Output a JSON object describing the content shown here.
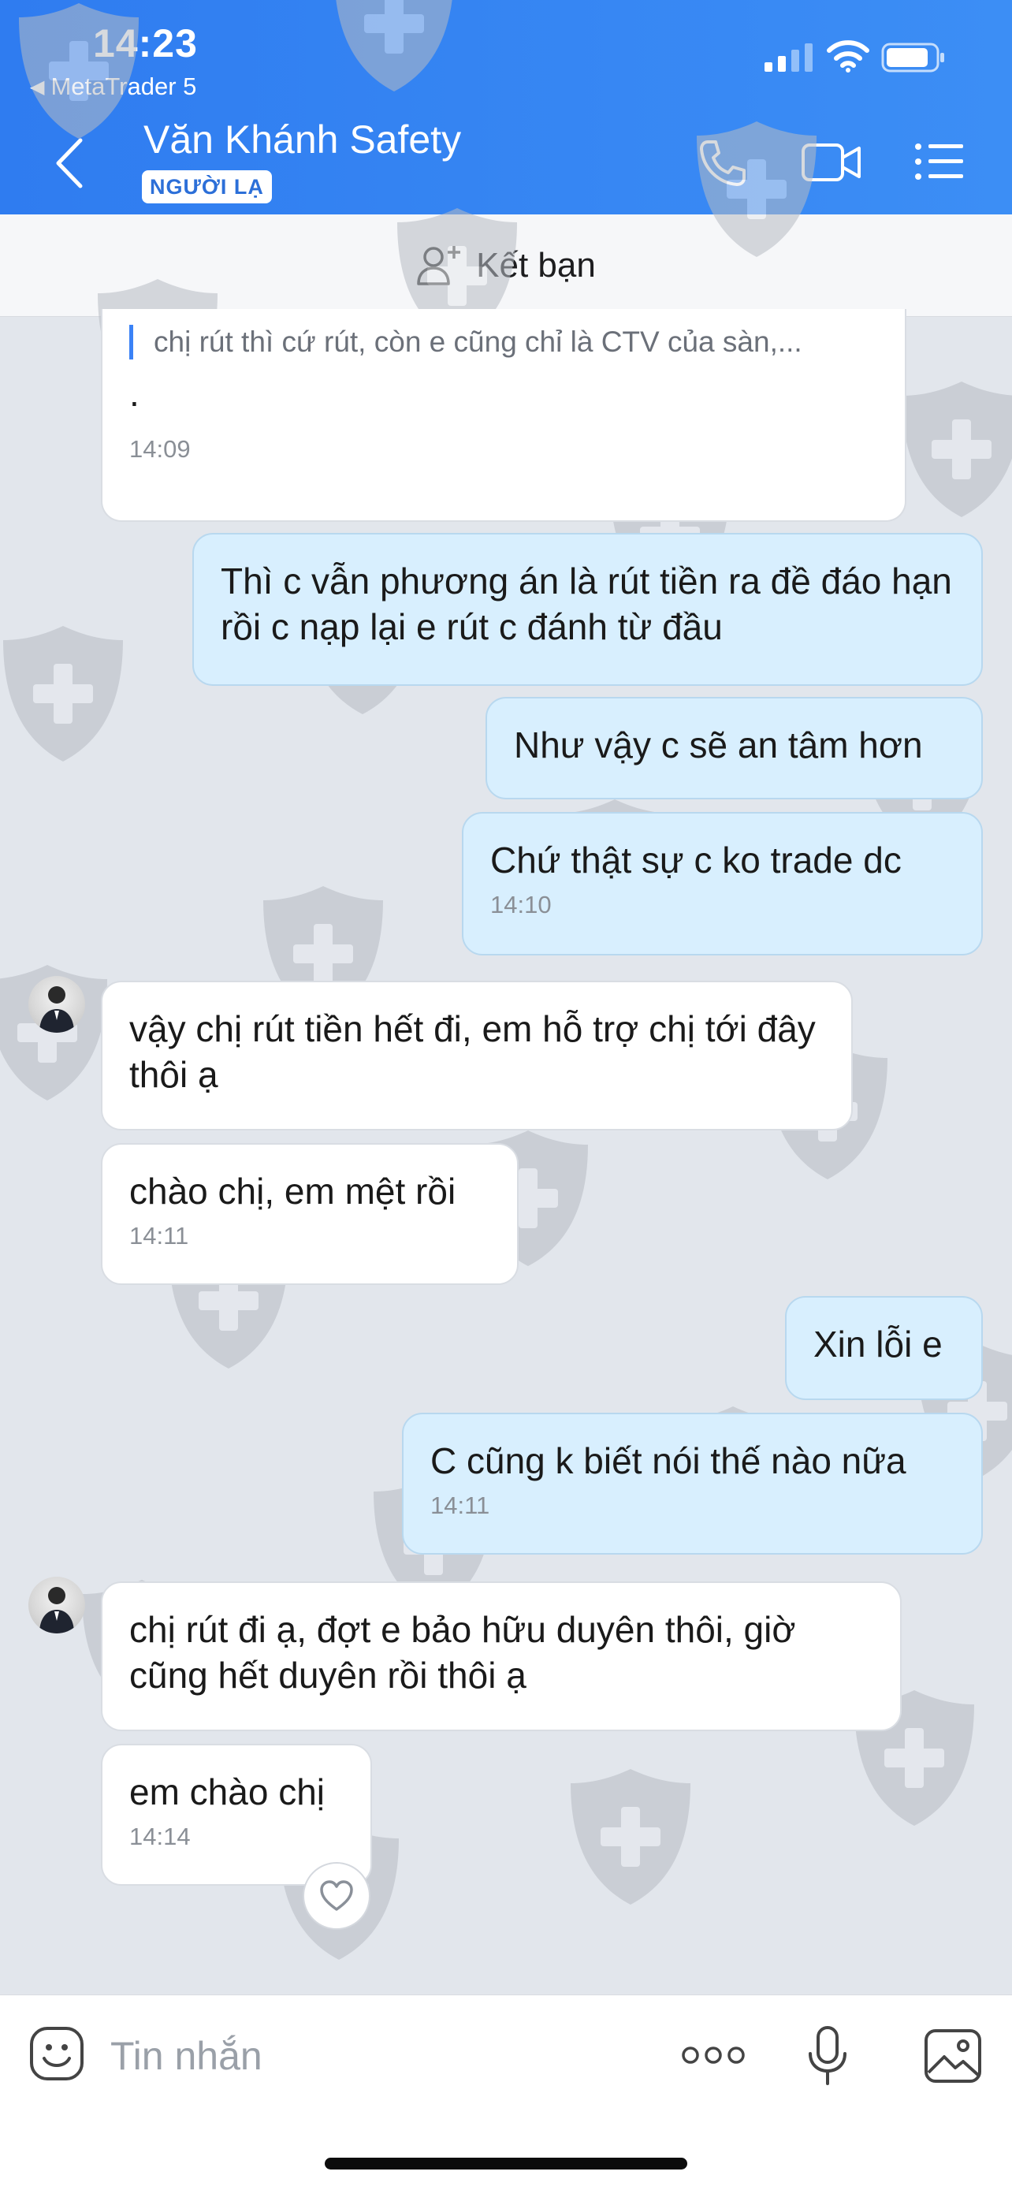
{
  "status_bar": {
    "time": "14:23",
    "back_app_label": "MetaTrader 5"
  },
  "header": {
    "contact_name": "Văn Khánh Safety",
    "badge": "NGƯỜI LẠ",
    "icons": [
      "back-icon",
      "phone-icon",
      "video-icon",
      "menu-list-icon"
    ]
  },
  "add_friend": {
    "label": "Kết bạn",
    "icon": "add-user-icon"
  },
  "messages": [
    {
      "direction": "in",
      "quote": "chị rút thì cứ rút, còn e cũng chỉ là CTV của sàn,...",
      "text": ".",
      "time": "14:09"
    },
    {
      "direction": "out",
      "text": "Thì c vẫn phương án là rút tiền ra đề đáo hạn rồi c nạp lại e rút c đánh từ đầu"
    },
    {
      "direction": "out",
      "text": "Như vậy c sẽ an tâm hơn"
    },
    {
      "direction": "out",
      "text": "Chứ thật sự c ko trade dc",
      "time": "14:10"
    },
    {
      "direction": "in",
      "text": "vậy chị rút tiền hết đi, em hỗ trợ chị tới đây thôi ạ"
    },
    {
      "direction": "in",
      "text": "chào chị, em mệt rồi",
      "time": "14:11"
    },
    {
      "direction": "out",
      "text": "Xin lỗi e"
    },
    {
      "direction": "out",
      "text": "C cũng k biết nói thế nào nữa",
      "time": "14:11"
    },
    {
      "direction": "in",
      "text": "chị rút đi ạ, đợt e bảo hữu duyên thôi, giờ cũng hết duyên rồi thôi ạ"
    },
    {
      "direction": "in",
      "text": "em chào chị",
      "time": "14:14"
    }
  ],
  "input": {
    "placeholder": "Tin nhắn",
    "icons": [
      "emoji-icon",
      "more-icon",
      "microphone-icon",
      "image-icon"
    ]
  },
  "colors": {
    "header_blue": "#3388f3",
    "outgoing_bubble": "#d8effe",
    "incoming_bubble": "#ffffff",
    "chat_background": "#e2e6ec",
    "quote_bar": "#3b82f6"
  }
}
